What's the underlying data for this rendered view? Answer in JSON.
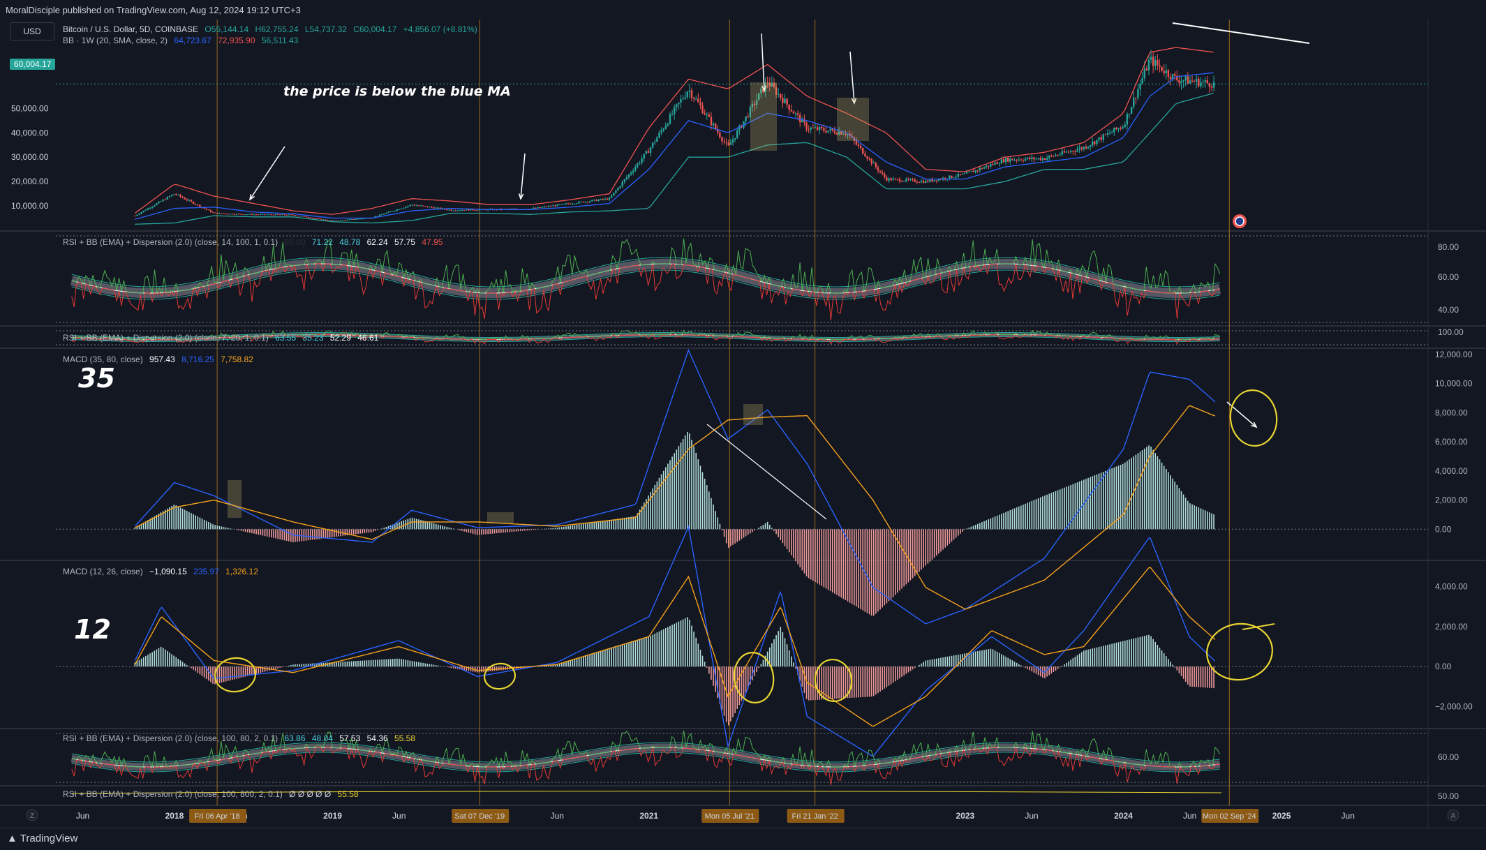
{
  "header": {
    "publish_line": "MoralDisciple published on TradingView.com, Aug 12, 2024 19:12 UTC+3",
    "currency": "USD"
  },
  "price_legend": {
    "symbol": "Bitcoin / U.S. Dollar, 5D, COINBASE",
    "o": "O55,144.14",
    "h": "H62,755.24",
    "l": "L54,737.32",
    "c": "C60,004.17",
    "chg": "+4,856.07 (+8.81%)",
    "bb_name": "BB · 1W (20, SMA, close, 2)",
    "bb_basis": "64,723.67",
    "bb_upper": "72,935.90",
    "bb_lower": "56,511.43"
  },
  "last_price_tag": "60,004.17",
  "price_axis": [
    "50,000.00",
    "40,000.00",
    "30,000.00",
    "20,000.00",
    "10,000.00"
  ],
  "annotation_text": "the price is below the blue MA",
  "rsi1": {
    "name": "RSI + BB (EMA) + Dispersion (2.0) (close, 14, 100, 1, 0.1)",
    "v0": "60.00",
    "v1": "71.22",
    "v2": "48.78",
    "v3": "62.24",
    "v4": "57.75",
    "v5": "47.95",
    "axis": [
      "80.00",
      "60.00",
      "40.00"
    ]
  },
  "rsi2": {
    "name": "RSI + BB (EMA) + Dispersion (2.0) (close, 7, 20, 1, 0.1)",
    "v1": "63.55",
    "v2": "35.23",
    "v3": "52.29",
    "v4": "46.61",
    "axis": "100.00"
  },
  "macd1": {
    "name": "MACD (35, 80, close)",
    "hist": "957.43",
    "macd": "8,716.25",
    "signal": "7,758.82",
    "big_label": "35",
    "axis": [
      "12,000.00",
      "10,000.00",
      "8,000.00",
      "6,000.00",
      "4,000.00",
      "2,000.00",
      "0.00"
    ]
  },
  "macd2": {
    "name": "MACD (12, 26, close)",
    "hist": "−1,090.15",
    "macd": "235.97",
    "signal": "1,326.12",
    "big_label": "12",
    "axis": [
      "4,000.00",
      "2,000.00",
      "0.00",
      "−2,000.00"
    ]
  },
  "rsi3": {
    "name": "RSI + BB (EMA) + Dispersion (2.0) (close, 100, 80, 2, 0.1)",
    "v1": "63.86",
    "v2": "48.04",
    "v3": "57.53",
    "v4": "54.36",
    "v5": "55.58",
    "axis": "60.00"
  },
  "rsi4": {
    "name": "RSI + BB (EMA) + Dispersion (2.0) (close, 100, 800, 2, 0.1)",
    "v0": "Ø Ø Ø Ø Ø",
    "v1": "55.58",
    "axis": "50.00"
  },
  "time_axis": [
    {
      "label": "Jun",
      "bold": false
    },
    {
      "label": "2018",
      "bold": true
    },
    {
      "label": "Jun",
      "bold": false
    },
    {
      "label": "2019",
      "bold": true
    },
    {
      "label": "Jun",
      "bold": false
    },
    {
      "label": "Jun",
      "bold": false
    },
    {
      "label": "2021",
      "bold": true
    },
    {
      "label": "Jun",
      "bold": false
    },
    {
      "label": "2023",
      "bold": true
    },
    {
      "label": "Jun",
      "bold": false
    },
    {
      "label": "2024",
      "bold": true
    },
    {
      "label": "Jun",
      "bold": false
    },
    {
      "label": "2025",
      "bold": true
    },
    {
      "label": "Jun",
      "bold": false
    }
  ],
  "date_markers": [
    "Fri 06 Apr '18",
    "Sat 07 Dec '19",
    "Mon 05 Jul '21",
    "Fri 21 Jan '22",
    "Mon 02 Sep '24"
  ],
  "footer": {
    "brand": "TradingView",
    "left_btn": "Z",
    "right_btn": "A"
  },
  "colors": {
    "bg": "#131722",
    "green": "#26a69a",
    "red": "#ef5350",
    "blue": "#2962ff",
    "orange": "#f7a21b",
    "yellow": "#e8d431",
    "marker": "#8c5a14"
  },
  "chart_data": [
    {
      "type": "candlestick",
      "title": "Bitcoin / U.S. Dollar, 5D, COINBASE",
      "x": [
        "2017-10",
        "2018-01",
        "2018-04",
        "2018-07",
        "2018-10",
        "2019-01",
        "2019-04",
        "2019-07",
        "2019-10",
        "2020-01",
        "2020-04",
        "2020-07",
        "2020-10",
        "2021-01",
        "2021-04",
        "2021-07",
        "2021-10",
        "2022-01",
        "2022-04",
        "2022-07",
        "2022-10",
        "2023-01",
        "2023-04",
        "2023-07",
        "2023-10",
        "2024-01",
        "2024-03",
        "2024-05",
        "2024-08"
      ],
      "close": [
        6000,
        15000,
        7000,
        6500,
        6300,
        3800,
        5200,
        10500,
        8300,
        8500,
        8800,
        11000,
        13000,
        33000,
        58000,
        34000,
        61000,
        42000,
        40000,
        21000,
        20000,
        23000,
        29000,
        29500,
        34000,
        43000,
        70000,
        62000,
        60004
      ],
      "bb_basis": [
        4500,
        9000,
        9500,
        7500,
        6800,
        5000,
        5000,
        8000,
        9000,
        8500,
        8500,
        9500,
        11000,
        25000,
        45000,
        40000,
        48000,
        45000,
        40000,
        28000,
        21000,
        21000,
        26000,
        28000,
        30000,
        38000,
        55000,
        63000,
        64724
      ],
      "bb_upper": [
        7000,
        19000,
        14000,
        11000,
        8000,
        6500,
        9000,
        13000,
        12000,
        10500,
        10500,
        12500,
        15000,
        42000,
        62000,
        58000,
        68000,
        55000,
        48000,
        40000,
        25000,
        24000,
        30000,
        32000,
        36000,
        48000,
        73000,
        75000,
        72936
      ],
      "bb_lower": [
        2500,
        3000,
        6000,
        5500,
        5500,
        3500,
        3000,
        4000,
        7000,
        7000,
        6500,
        7500,
        8000,
        9000,
        30000,
        30000,
        35000,
        36000,
        30000,
        17000,
        17000,
        17000,
        20000,
        25000,
        25000,
        28000,
        40000,
        52000,
        56511
      ],
      "ylim": [
        0,
        75000
      ]
    },
    {
      "type": "line",
      "title": "MACD (35, 80, close)",
      "x": [
        "2017-10",
        "2018-01",
        "2018-04",
        "2018-10",
        "2019-04",
        "2019-07",
        "2019-12",
        "2020-06",
        "2020-12",
        "2021-04",
        "2021-07",
        "2021-10",
        "2022-01",
        "2022-06",
        "2022-10",
        "2023-01",
        "2023-07",
        "2024-01",
        "2024-03",
        "2024-06",
        "2024-08"
      ],
      "series": [
        {
          "name": "MACD",
          "values": [
            200,
            3200,
            2300,
            -400,
            -900,
            1300,
            100,
            300,
            1700,
            12300,
            6200,
            8200,
            4500,
            -4000,
            -6500,
            -5500,
            -2000,
            5500,
            10800,
            10300,
            8716
          ]
        },
        {
          "name": "Signal",
          "values": [
            100,
            1500,
            2000,
            500,
            -700,
            500,
            500,
            200,
            800,
            5500,
            7500,
            7700,
            7800,
            2000,
            -4000,
            -5500,
            -3500,
            1000,
            5000,
            8500,
            7759
          ]
        },
        {
          "name": "Histogram",
          "values": [
            100,
            1700,
            300,
            -900,
            -200,
            800,
            -400,
            100,
            900,
            6800,
            -1300,
            500,
            -3300,
            -6000,
            -2500,
            0,
            2300,
            4500,
            5800,
            1800,
            957
          ]
        }
      ],
      "ylim": [
        -2000,
        12000
      ]
    },
    {
      "type": "line",
      "title": "MACD (12, 26, close)",
      "x": [
        "2017-10",
        "2017-12",
        "2018-04",
        "2018-10",
        "2019-06",
        "2019-12",
        "2020-06",
        "2021-01",
        "2021-04",
        "2021-07",
        "2021-11",
        "2022-01",
        "2022-06",
        "2022-10",
        "2023-03",
        "2023-07",
        "2023-10",
        "2024-03",
        "2024-06",
        "2024-08"
      ],
      "series": [
        {
          "name": "MACD",
          "values": [
            300,
            3000,
            -600,
            -200,
            1300,
            -500,
            200,
            2500,
            7000,
            -4000,
            3800,
            -2500,
            -4500,
            -1200,
            1500,
            -300,
            1800,
            6500,
            1500,
            236
          ]
        },
        {
          "name": "Signal",
          "values": [
            100,
            2500,
            300,
            -300,
            1000,
            -200,
            100,
            1500,
            4500,
            -1500,
            3000,
            -800,
            -3000,
            -1500,
            1800,
            600,
            1000,
            5000,
            2500,
            1326
          ]
        },
        {
          "name": "Histogram",
          "values": [
            200,
            1000,
            -900,
            100,
            400,
            -300,
            100,
            1500,
            2500,
            -3000,
            2000,
            -1700,
            -1500,
            300,
            900,
            -600,
            800,
            1600,
            -1000,
            -1090
          ]
        }
      ],
      "ylim": [
        -3000,
        5000
      ]
    }
  ]
}
